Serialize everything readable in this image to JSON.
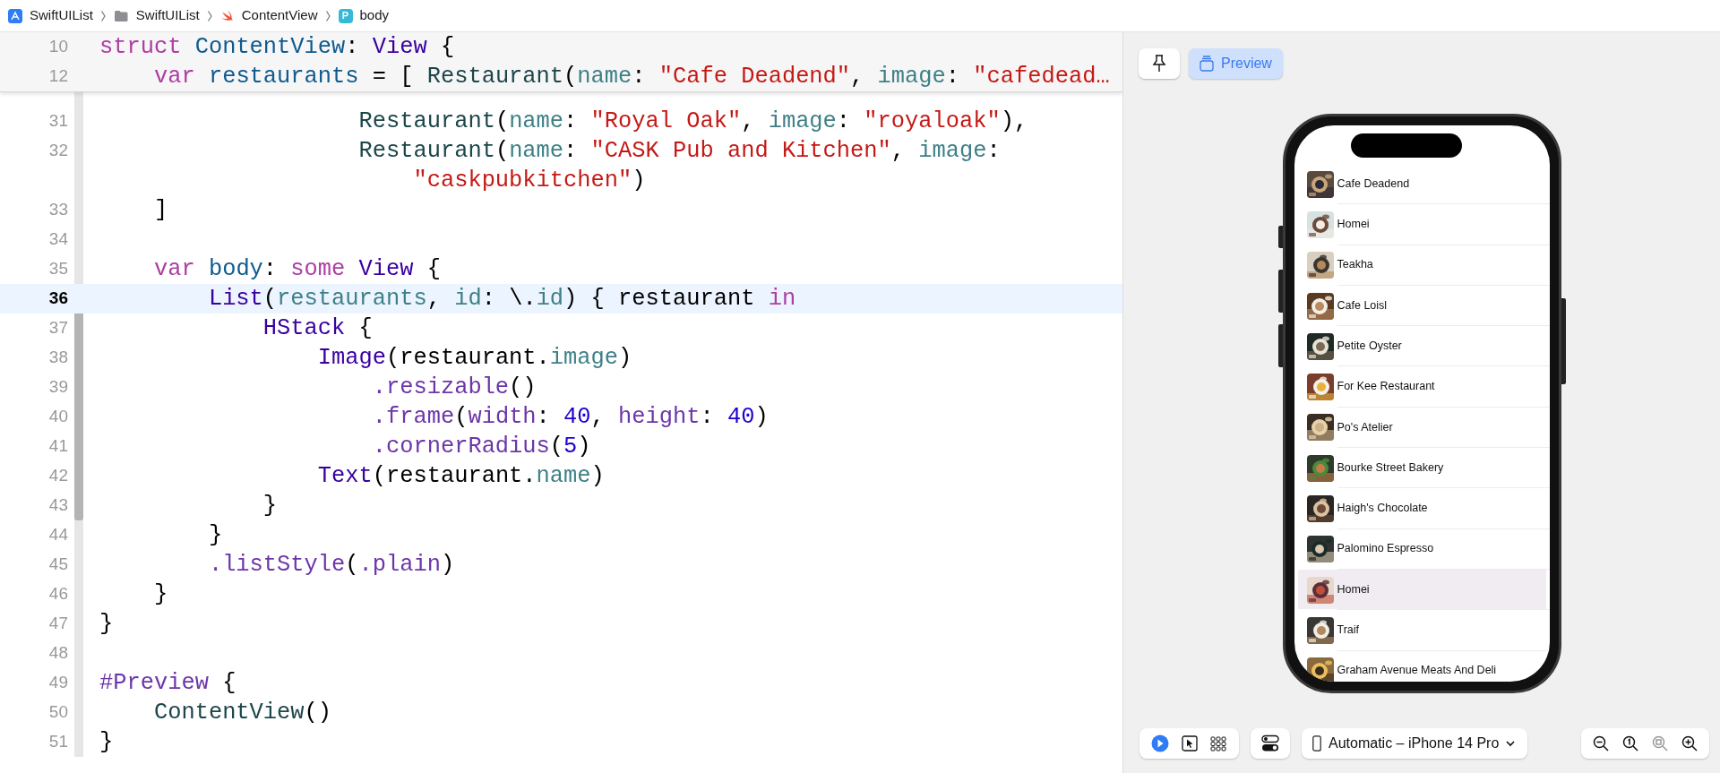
{
  "breadcrumb": [
    {
      "kind": "app",
      "label": "SwiftUIList"
    },
    {
      "kind": "folder",
      "label": "SwiftUIList"
    },
    {
      "kind": "swift",
      "label": "ContentView"
    },
    {
      "kind": "property",
      "badge": "P",
      "label": "body"
    }
  ],
  "editor": {
    "sticky_header": [
      {
        "number": "10",
        "current": false,
        "tokens": [
          {
            "text": "struct ",
            "kind": "keyword"
          },
          {
            "text": "ContentView",
            "kind": "declaration"
          },
          {
            "text": ": ",
            "kind": "plain"
          },
          {
            "text": "View",
            "kind": "type"
          },
          {
            "text": " {",
            "kind": "plain"
          }
        ]
      },
      {
        "number": "12",
        "current": false,
        "tokens": [
          {
            "text": "    var ",
            "kind": "keyword"
          },
          {
            "text": "restaurants",
            "kind": "declaration"
          },
          {
            "text": " = [ ",
            "kind": "plain"
          },
          {
            "text": "Restaurant",
            "kind": "project"
          },
          {
            "text": "(",
            "kind": "plain"
          },
          {
            "text": "name",
            "kind": "property"
          },
          {
            "text": ": ",
            "kind": "plain"
          },
          {
            "text": "\"Cafe Deadend\"",
            "kind": "string"
          },
          {
            "text": ", ",
            "kind": "plain"
          },
          {
            "text": "image",
            "kind": "property"
          },
          {
            "text": ": ",
            "kind": "plain"
          },
          {
            "text": "\"cafedead…",
            "kind": "string"
          }
        ]
      }
    ],
    "lines": [
      {
        "number": "31",
        "current": false,
        "tokens": [
          {
            "text": "                   Restaurant",
            "kind": "project"
          },
          {
            "text": "(",
            "kind": "plain"
          },
          {
            "text": "name",
            "kind": "property"
          },
          {
            "text": ": ",
            "kind": "plain"
          },
          {
            "text": "\"Royal Oak\"",
            "kind": "string"
          },
          {
            "text": ", ",
            "kind": "plain"
          },
          {
            "text": "image",
            "kind": "property"
          },
          {
            "text": ": ",
            "kind": "plain"
          },
          {
            "text": "\"royaloak\"",
            "kind": "string"
          },
          {
            "text": "),",
            "kind": "plain"
          }
        ]
      },
      {
        "number": "32",
        "current": false,
        "tokens": [
          {
            "text": "                   Restaurant",
            "kind": "project"
          },
          {
            "text": "(",
            "kind": "plain"
          },
          {
            "text": "name",
            "kind": "property"
          },
          {
            "text": ": ",
            "kind": "plain"
          },
          {
            "text": "\"CASK Pub and Kitchen\"",
            "kind": "string"
          },
          {
            "text": ", ",
            "kind": "plain"
          },
          {
            "text": "image",
            "kind": "property"
          },
          {
            "text": ":",
            "kind": "plain"
          }
        ]
      },
      {
        "current": false,
        "tokens": [
          {
            "text": "                       \"caskpubkitchen\"",
            "kind": "string"
          },
          {
            "text": ")",
            "kind": "plain"
          }
        ]
      },
      {
        "number": "33",
        "current": false,
        "tokens": [
          {
            "text": "    ]",
            "kind": "plain"
          }
        ]
      },
      {
        "number": "34",
        "current": false
      },
      {
        "number": "35",
        "current": false,
        "tokens": [
          {
            "text": "    var ",
            "kind": "keyword"
          },
          {
            "text": "body",
            "kind": "declaration"
          },
          {
            "text": ": ",
            "kind": "plain"
          },
          {
            "text": "some ",
            "kind": "keyword"
          },
          {
            "text": "View",
            "kind": "type"
          },
          {
            "text": " {",
            "kind": "plain"
          }
        ]
      },
      {
        "number": "36",
        "current": true,
        "tokens": [
          {
            "text": "        List",
            "kind": "type"
          },
          {
            "text": "(",
            "kind": "plain"
          },
          {
            "text": "restaurants",
            "kind": "property"
          },
          {
            "text": ", ",
            "kind": "plain"
          },
          {
            "text": "id",
            "kind": "property"
          },
          {
            "text": ": \\.",
            "kind": "plain"
          },
          {
            "text": "id",
            "kind": "property"
          },
          {
            "text": ") { restaurant ",
            "kind": "plain"
          },
          {
            "text": "in",
            "kind": "keyword"
          }
        ]
      },
      {
        "number": "37",
        "current": false,
        "tokens": [
          {
            "text": "            HStack",
            "kind": "type"
          },
          {
            "text": " {",
            "kind": "plain"
          }
        ]
      },
      {
        "number": "38",
        "current": false,
        "tokens": [
          {
            "text": "                Image",
            "kind": "type"
          },
          {
            "text": "(restaurant.",
            "kind": "plain"
          },
          {
            "text": "image",
            "kind": "property"
          },
          {
            "text": ")",
            "kind": "plain"
          }
        ]
      },
      {
        "number": "39",
        "current": false,
        "tokens": [
          {
            "text": "                    .resizable",
            "kind": "method"
          },
          {
            "text": "()",
            "kind": "plain"
          }
        ]
      },
      {
        "number": "40",
        "current": false,
        "tokens": [
          {
            "text": "                    .frame",
            "kind": "method"
          },
          {
            "text": "(",
            "kind": "plain"
          },
          {
            "text": "width",
            "kind": "method"
          },
          {
            "text": ": ",
            "kind": "plain"
          },
          {
            "text": "40",
            "kind": "number"
          },
          {
            "text": ", ",
            "kind": "plain"
          },
          {
            "text": "height",
            "kind": "method"
          },
          {
            "text": ": ",
            "kind": "plain"
          },
          {
            "text": "40",
            "kind": "number"
          },
          {
            "text": ")",
            "kind": "plain"
          }
        ]
      },
      {
        "number": "41",
        "current": false,
        "tokens": [
          {
            "text": "                    .cornerRadius",
            "kind": "method"
          },
          {
            "text": "(",
            "kind": "plain"
          },
          {
            "text": "5",
            "kind": "number"
          },
          {
            "text": ")",
            "kind": "plain"
          }
        ]
      },
      {
        "number": "42",
        "current": false,
        "tokens": [
          {
            "text": "                Text",
            "kind": "type"
          },
          {
            "text": "(restaurant.",
            "kind": "plain"
          },
          {
            "text": "name",
            "kind": "property"
          },
          {
            "text": ")",
            "kind": "plain"
          }
        ]
      },
      {
        "number": "43",
        "current": false,
        "tokens": [
          {
            "text": "            }",
            "kind": "plain"
          }
        ]
      },
      {
        "number": "44",
        "current": false,
        "tokens": [
          {
            "text": "        }",
            "kind": "plain"
          }
        ]
      },
      {
        "number": "45",
        "current": false,
        "tokens": [
          {
            "text": "        .listStyle",
            "kind": "method"
          },
          {
            "text": "(",
            "kind": "plain"
          },
          {
            "text": ".plain",
            "kind": "method"
          },
          {
            "text": ")",
            "kind": "plain"
          }
        ]
      },
      {
        "number": "46",
        "current": false,
        "tokens": [
          {
            "text": "    }",
            "kind": "plain"
          }
        ]
      },
      {
        "number": "47",
        "current": false,
        "tokens": [
          {
            "text": "}",
            "kind": "plain"
          }
        ]
      },
      {
        "number": "48",
        "current": false
      },
      {
        "number": "49",
        "current": false,
        "tokens": [
          {
            "text": "#Preview",
            "kind": "method"
          },
          {
            "text": " {",
            "kind": "plain"
          }
        ]
      },
      {
        "number": "50",
        "current": false,
        "tokens": [
          {
            "text": "    ContentView",
            "kind": "project"
          },
          {
            "text": "()",
            "kind": "plain"
          }
        ]
      },
      {
        "number": "51",
        "current": false,
        "tokens": [
          {
            "text": "}",
            "kind": "plain"
          }
        ]
      }
    ]
  },
  "preview": {
    "pin": {
      "on": false
    },
    "preview_button": {
      "label": "Preview",
      "selected": true
    },
    "list": [
      {
        "name": "Cafe Deadend",
        "selected": false
      },
      {
        "name": "Homei",
        "selected": false
      },
      {
        "name": "Teakha",
        "selected": false
      },
      {
        "name": "Cafe Loisl",
        "selected": false
      },
      {
        "name": "Petite Oyster",
        "selected": false
      },
      {
        "name": "For Kee Restaurant",
        "selected": false
      },
      {
        "name": "Po's Atelier",
        "selected": false
      },
      {
        "name": "Bourke Street Bakery",
        "selected": false
      },
      {
        "name": "Haigh's Chocolate",
        "selected": false
      },
      {
        "name": "Palomino Espresso",
        "selected": false
      },
      {
        "name": "Homei",
        "selected": true
      },
      {
        "name": "Traif",
        "selected": false
      },
      {
        "name": "Graham Avenue Meats And Deli",
        "selected": false
      }
    ],
    "modes": [
      {
        "kind": "live",
        "selected": true
      },
      {
        "kind": "select",
        "selected": false
      },
      {
        "kind": "variants",
        "selected": false
      }
    ],
    "device": "Automatic – iPhone 14 Pro"
  }
}
